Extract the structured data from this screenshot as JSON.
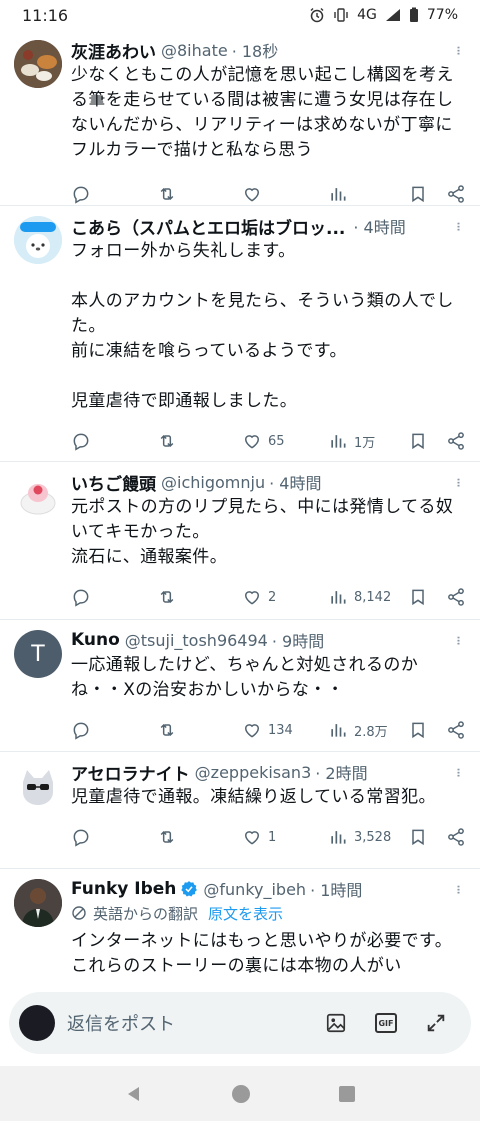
{
  "status_bar": {
    "time": "11:16",
    "network": "4G",
    "battery": "77%"
  },
  "tweets": [
    {
      "name": "灰涯あわい",
      "handle": "@8ihate",
      "time": "· 18秒",
      "text": "少なくともこの人が記憶を思い起こし構図を考える筆を走らせている間は被害に遭う女児は存在しないんだから、リアリティーは求めないが丁寧にフルカラーで描けと私なら思う",
      "likes": "",
      "views": ""
    },
    {
      "name": "こあら（スパムとエロ垢はブロッ...",
      "handle": "",
      "time": "· 4時間",
      "text": "フォロー外から失礼します。\n\n本人のアカウントを見たら、そういう類の人でした。\n前に凍結を喰らっているようです。\n\n児童虐待で即通報しました。",
      "likes": "65",
      "views": "1万"
    },
    {
      "name": "いちご饅頭",
      "handle": "@ichigomnju",
      "time": "· 4時間",
      "text": "元ポストの方のリプ見たら、中には発情してる奴いてキモかった。\n流石に、通報案件。",
      "likes": "2",
      "views": "8,142"
    },
    {
      "name": "Kuno",
      "handle": "@tsuji_tosh96494",
      "time": "· 9時間",
      "avatar_letter": "T",
      "text": "一応通報したけど、ちゃんと対処されるのかね・・Xの治安おかしいからな・・",
      "likes": "134",
      "views": "2.8万"
    },
    {
      "name": "アセロラナイト",
      "handle": "@zeppekisan3",
      "time": "· 2時間",
      "text": "児童虐待で通報。凍結繰り返している常習犯。",
      "likes": "1",
      "views": "3,528"
    },
    {
      "name": "Funky Ibeh",
      "handle": "@funky_ibeh",
      "time": "· 1時間",
      "translation_label": "英語からの翻訳",
      "translation_link": "原文を表示",
      "text": "インターネットにはもっと思いやりが必要です。これらのストーリーの裏には本物の人がい"
    }
  ],
  "reply_bar": {
    "placeholder": "返信をポスト"
  },
  "colors": {
    "accent": "#1d9bf0",
    "secondary_text": "#536471"
  }
}
